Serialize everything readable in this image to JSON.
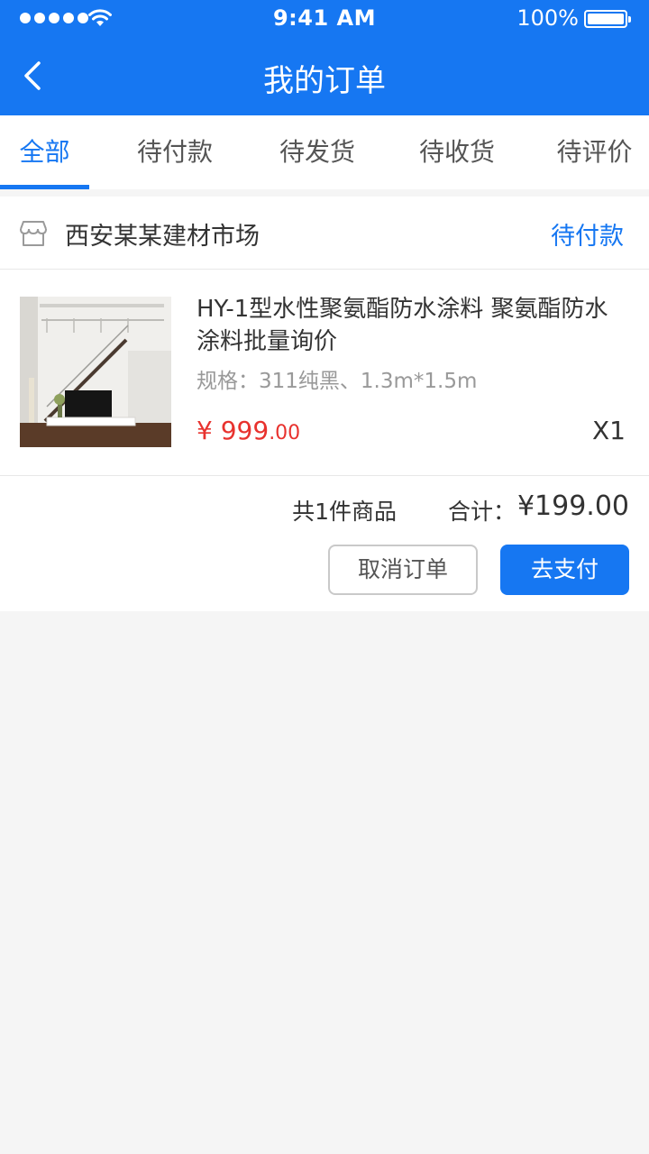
{
  "status_bar": {
    "time": "9:41 AM",
    "battery": "100%"
  },
  "nav": {
    "title": "我的订单",
    "back_icon": "chevron-left-icon"
  },
  "tabs": [
    {
      "label": "全部",
      "active": true
    },
    {
      "label": "待付款",
      "active": false
    },
    {
      "label": "待发货",
      "active": false
    },
    {
      "label": "待收货",
      "active": false
    },
    {
      "label": "待评价",
      "active": false
    }
  ],
  "order": {
    "shop_icon": "store-icon",
    "shop_name": "西安某某建材市场",
    "status": "待付款",
    "product": {
      "name": "HY-1型水性聚氨酯防水涂料 聚氨酯防水涂料批量询价",
      "spec": "规格：311纯黑、1.3m*1.5m",
      "price_symbol": "¥",
      "price_int": "999",
      "price_cents": ".00",
      "quantity": "X1"
    },
    "item_count": "共1件商品",
    "total_label": "合计：",
    "total_amount": "¥199.00",
    "cancel_label": "取消订单",
    "pay_label": "去支付"
  },
  "colors": {
    "primary": "#1677f2",
    "price": "#e8322e",
    "background": "#f5f5f5"
  }
}
